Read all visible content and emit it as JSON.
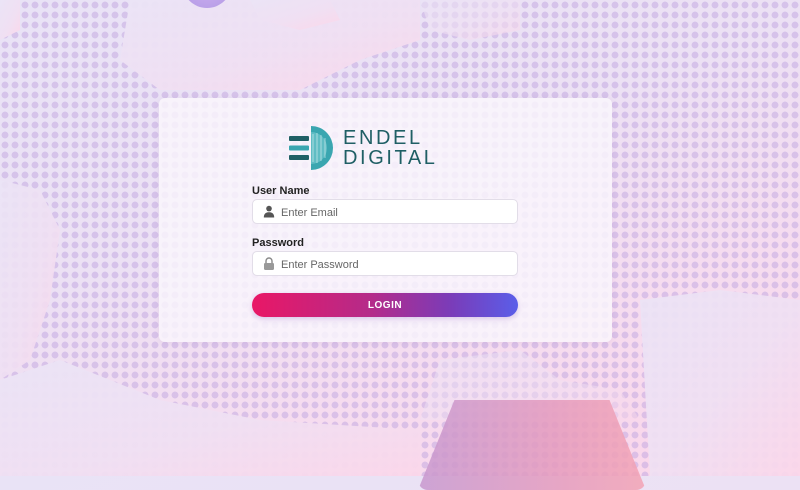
{
  "brand": {
    "line1": "ENDEL",
    "line2": "DIGITAL",
    "color": "#1f5f65",
    "accent": "#3aa6b0"
  },
  "form": {
    "username": {
      "label": "User Name",
      "placeholder": "Enter Email",
      "icon": "user-icon"
    },
    "password": {
      "label": "Password",
      "placeholder": "Enter Password",
      "icon": "lock-icon"
    },
    "submit_label": "LOGIN"
  }
}
